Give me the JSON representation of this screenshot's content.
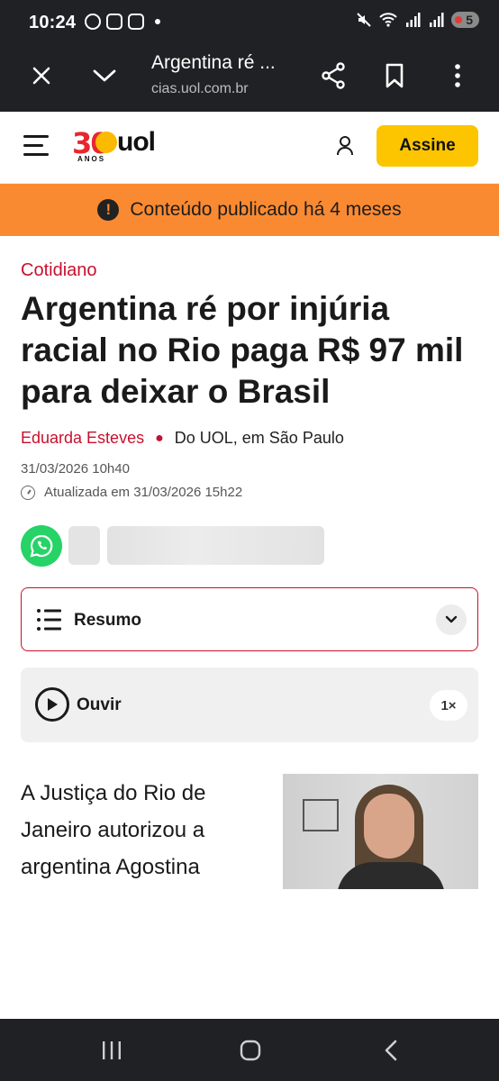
{
  "status": {
    "time": "10:24",
    "battery": "5"
  },
  "browser": {
    "title": "Argentina ré ...",
    "url": "cias.uol.com.br",
    "icons": [
      "close-icon",
      "chevron-down-icon",
      "share-icon",
      "bookmark-icon",
      "more-vertical-icon"
    ]
  },
  "header": {
    "logo_30": "30",
    "logo_brand": "uol",
    "logo_sub": "ANOS",
    "subscribe_label": "Assine",
    "accent_color": "#fcc500"
  },
  "notice": {
    "text": "Conteúdo publicado há 4 meses",
    "color": "#fa8a32"
  },
  "article": {
    "category": "Cotidiano",
    "headline": "Argentina ré por injúria racial no Rio paga R$ 97 mil para deixar o Brasil",
    "author": "Eduarda Esteves",
    "source": "Do UOL, em São Paulo",
    "published": "31/03/2026 10h40",
    "updated": "Atualizada em 31/03/2026 15h22",
    "summary_label": "Resumo",
    "listen_label": "Ouvir",
    "speed": "1×",
    "body_start": "A Justiça do Rio de Janeiro autorizou a argentina Agostina",
    "accent_red": "#c8102e"
  }
}
